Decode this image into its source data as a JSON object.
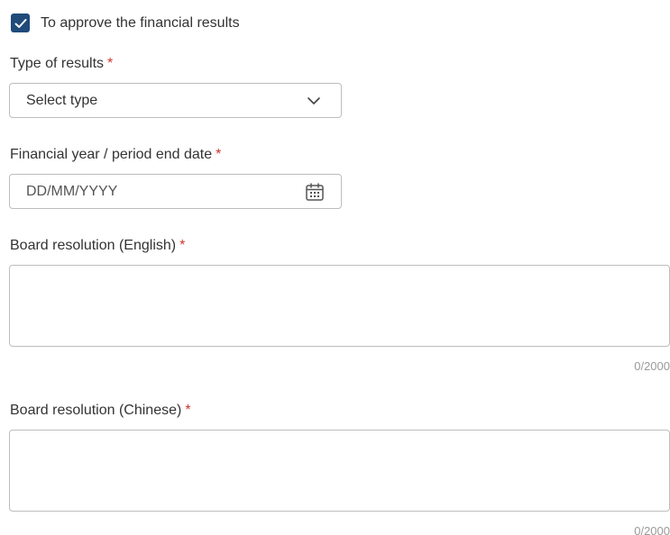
{
  "approve": {
    "checked": true,
    "label": "To approve the financial results"
  },
  "type_of_results": {
    "label": "Type of results",
    "required_mark": "*",
    "selected": "Select type",
    "icon": "chevron-down-icon"
  },
  "period_end_date": {
    "label": "Financial year / period end date",
    "required_mark": "*",
    "placeholder": "DD/MM/YYYY",
    "icon": "calendar-icon"
  },
  "resolution_english": {
    "label": "Board resolution (English)",
    "required_mark": "*",
    "counter": "0/2000"
  },
  "resolution_chinese": {
    "label": "Board resolution (Chinese)",
    "required_mark": "*",
    "counter": "0/2000"
  },
  "colors": {
    "checkbox": "#1f4a7a",
    "required": "#d0342c",
    "border": "#bdbdbd"
  }
}
